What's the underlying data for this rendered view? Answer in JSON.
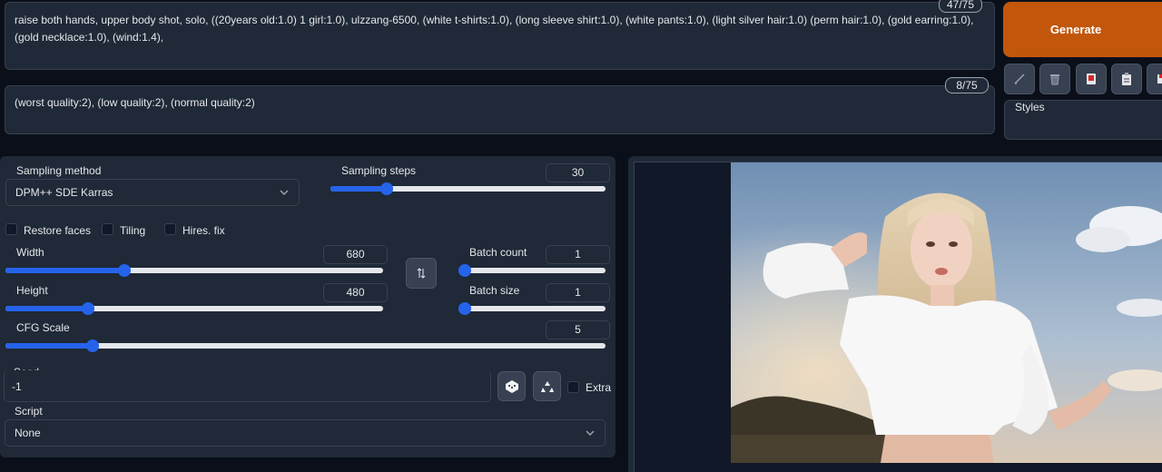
{
  "prompt": {
    "positive": "raise both hands, upper body shot, solo, ((20years old:1.0) 1 girl:1.0), ulzzang-6500, (white t-shirts:1.0), (long sleeve shirt:1.0), (white pants:1.0), (light silver hair:1.0) (perm hair:1.0), (gold earring:1.0), (gold necklace:1.0), (wind:1.4),",
    "positive_count": "47/75",
    "negative": "(worst quality:2), (low quality:2), (normal quality:2)",
    "negative_count": "8/75"
  },
  "actions": {
    "generate_label": "Generate",
    "styles_label": "Styles",
    "tools": [
      "pencil-icon",
      "trash-icon",
      "card-icon",
      "clipboard-icon",
      "save-icon"
    ]
  },
  "settings": {
    "sampling_method_label": "Sampling method",
    "sampling_method_value": "DPM++ SDE Karras",
    "sampling_steps_label": "Sampling steps",
    "sampling_steps_value": "30",
    "restore_faces": "Restore faces",
    "tiling": "Tiling",
    "hires_fix": "Hires. fix",
    "width_label": "Width",
    "width_value": "680",
    "height_label": "Height",
    "height_value": "480",
    "batch_count_label": "Batch count",
    "batch_count_value": "1",
    "batch_size_label": "Batch size",
    "batch_size_value": "1",
    "cfg_label": "CFG Scale",
    "cfg_value": "5",
    "seed_label": "Seed",
    "seed_value": "-1",
    "extra_label": "Extra",
    "script_label": "Script",
    "script_value": "None"
  },
  "colors": {
    "accent": "#2563eb",
    "generate": "#c2570c",
    "panel": "#1f2937",
    "bg": "#0b0f19"
  }
}
